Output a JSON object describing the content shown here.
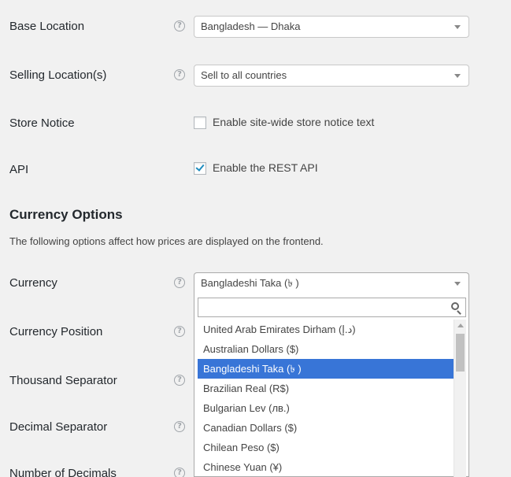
{
  "fields": {
    "base_location": {
      "label": "Base Location",
      "value": "Bangladesh — Dhaka"
    },
    "selling_locations": {
      "label": "Selling Location(s)",
      "value": "Sell to all countries"
    },
    "store_notice": {
      "label": "Store Notice",
      "checkbox_label": "Enable site-wide store notice text",
      "checked": false
    },
    "api": {
      "label": "API",
      "checkbox_label": "Enable the REST API",
      "checked": true
    }
  },
  "help_icon_glyph": "?",
  "currency_options": {
    "heading": "Currency Options",
    "description": "The following options affect how prices are displayed on the frontend.",
    "currency": {
      "label": "Currency",
      "value": "Bangladeshi Taka (৳ )"
    },
    "currency_position": {
      "label": "Currency Position"
    },
    "thousand_separator": {
      "label": "Thousand Separator"
    },
    "decimal_separator": {
      "label": "Decimal Separator"
    },
    "number_of_decimals": {
      "label": "Number of Decimals"
    }
  },
  "dropdown": {
    "search_value": "",
    "options": [
      "United Arab Emirates Dirham (د.إ)",
      "Australian Dollars ($)",
      "Bangladeshi Taka (৳ )",
      "Brazilian Real (R$)",
      "Bulgarian Lev (лв.)",
      "Canadian Dollars ($)",
      "Chilean Peso ($)",
      "Chinese Yuan (¥)"
    ],
    "selected_index": 2
  },
  "colors": {
    "highlight": "#3875d7",
    "checkbox_tick": "#1e8cbe"
  }
}
